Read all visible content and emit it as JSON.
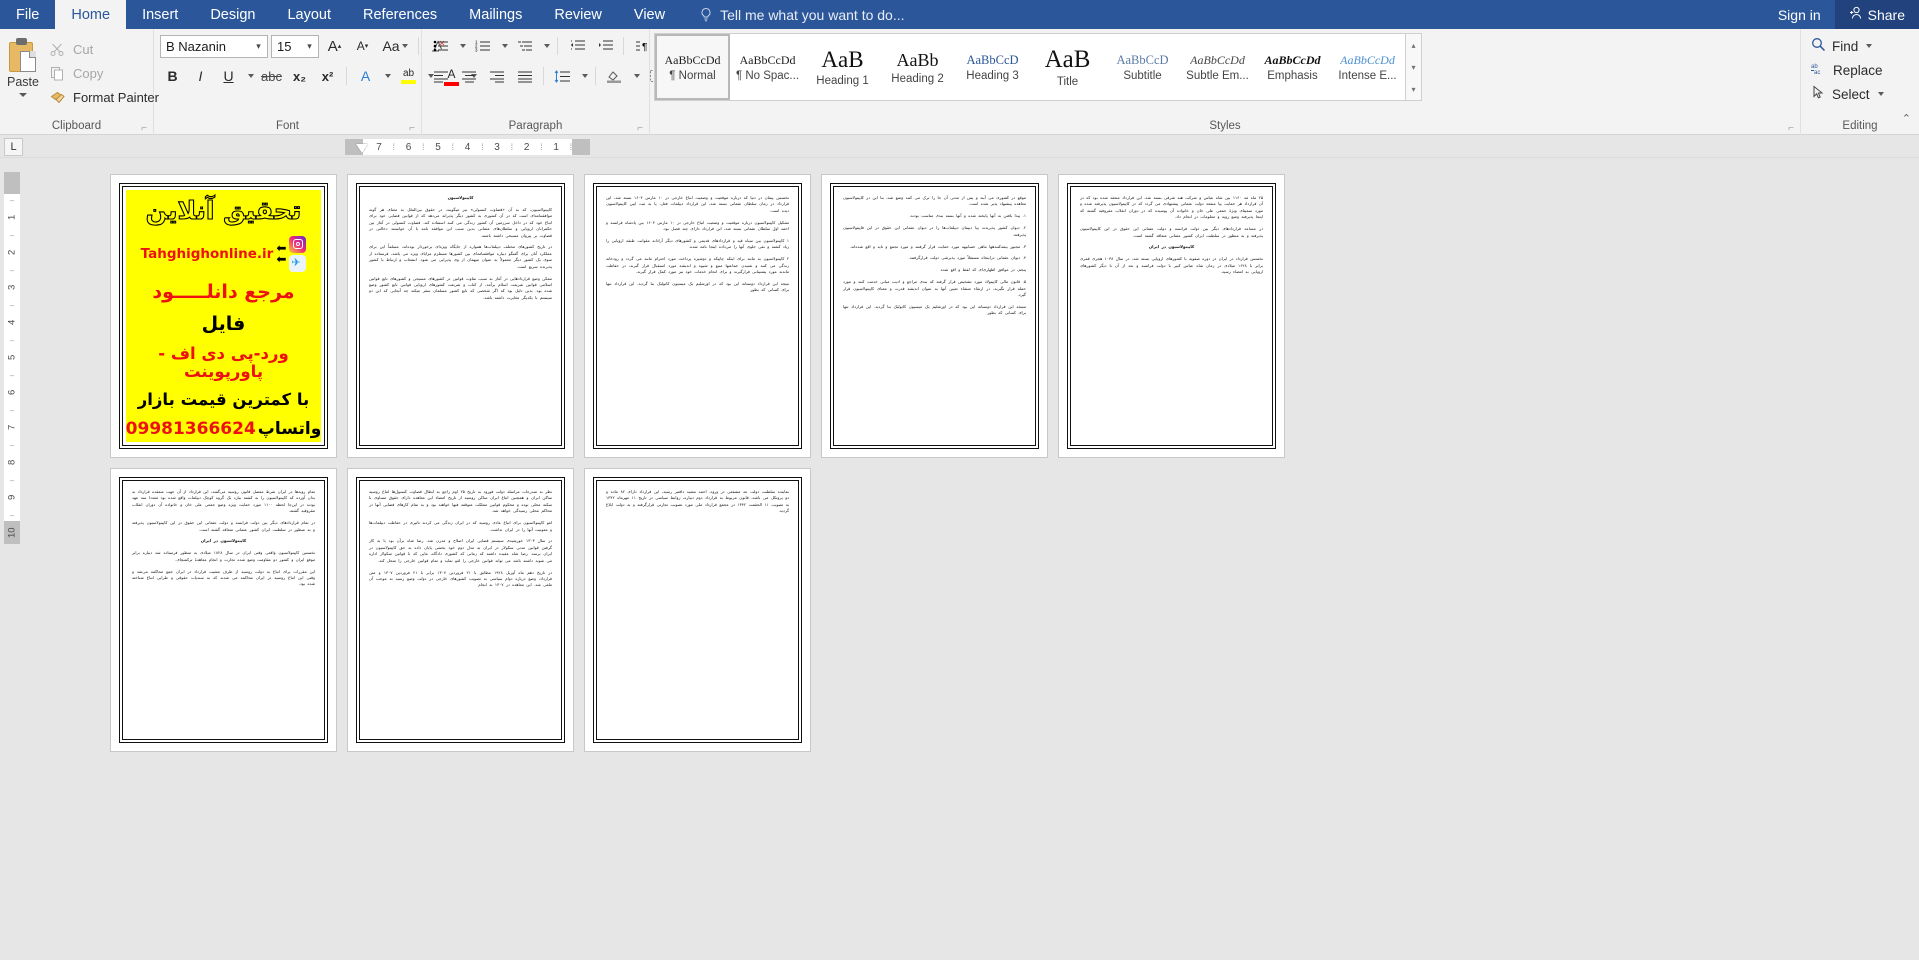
{
  "titlebar": {
    "tabs": [
      {
        "label": "File",
        "active": false
      },
      {
        "label": "Home",
        "active": true
      },
      {
        "label": "Insert",
        "active": false
      },
      {
        "label": "Design",
        "active": false
      },
      {
        "label": "Layout",
        "active": false
      },
      {
        "label": "References",
        "active": false
      },
      {
        "label": "Mailings",
        "active": false
      },
      {
        "label": "Review",
        "active": false
      },
      {
        "label": "View",
        "active": false
      }
    ],
    "tellme_placeholder": "Tell me what you want to do...",
    "signin_label": "Sign in",
    "share_label": "Share",
    "accent_color": "#2b579a"
  },
  "ribbon": {
    "clipboard": {
      "group_label": "Clipboard",
      "paste_label": "Paste",
      "cut_label": "Cut",
      "copy_label": "Copy",
      "format_painter_label": "Format Painter"
    },
    "font": {
      "group_label": "Font",
      "font_name": "B Nazanin",
      "font_size": "15",
      "grow_font": "A",
      "shrink_font": "A",
      "change_case": "Aa",
      "clear_formatting": "clear-formatting-icon",
      "bold": "B",
      "italic": "I",
      "underline": "U",
      "strikethrough": "abc",
      "subscript": "x₂",
      "superscript": "x²",
      "text_effects": "A",
      "highlight_color": "#ffff00",
      "font_color": "#ff0000"
    },
    "paragraph": {
      "group_label": "Paragraph"
    },
    "styles": {
      "group_label": "Styles",
      "items": [
        {
          "preview": "AaBbCcDd",
          "name": "¶ Normal",
          "selected": true,
          "size": "12px",
          "weight": "normal",
          "style": "normal",
          "color": "#1c1c1c"
        },
        {
          "preview": "AaBbCcDd",
          "name": "¶ No Spac...",
          "selected": false,
          "size": "12px",
          "weight": "normal",
          "style": "normal",
          "color": "#1c1c1c"
        },
        {
          "preview": "AaB",
          "name": "Heading 1",
          "selected": false,
          "size": "23px",
          "weight": "normal",
          "style": "normal",
          "color": "#111111"
        },
        {
          "preview": "AaBb",
          "name": "Heading 2",
          "selected": false,
          "size": "18px",
          "weight": "normal",
          "style": "normal",
          "color": "#111111"
        },
        {
          "preview": "AaBbCcD",
          "name": "Heading 3",
          "selected": false,
          "size": "12.5px",
          "weight": "normal",
          "style": "normal",
          "color": "#2b5797"
        },
        {
          "preview": "AaB",
          "name": "Title",
          "selected": false,
          "size": "25px",
          "weight": "normal",
          "style": "normal",
          "color": "#111111"
        },
        {
          "preview": "AaBbCcD",
          "name": "Subtitle",
          "selected": false,
          "size": "12.5px",
          "weight": "normal",
          "style": "normal",
          "color": "#5a7ca6"
        },
        {
          "preview": "AaBbCcDd",
          "name": "Subtle Em...",
          "selected": false,
          "size": "12px",
          "weight": "normal",
          "style": "italic",
          "color": "#444444"
        },
        {
          "preview": "AaBbCcDd",
          "name": "Emphasis",
          "selected": false,
          "size": "12px",
          "weight": "bold",
          "style": "italic",
          "color": "#111111"
        },
        {
          "preview": "AaBbCcDd",
          "name": "Intense E...",
          "selected": false,
          "size": "12px",
          "weight": "normal",
          "style": "italic",
          "color": "#4a8fd0"
        }
      ]
    },
    "editing": {
      "group_label": "Editing",
      "find_label": "Find",
      "replace_label": "Replace",
      "select_label": "Select"
    }
  },
  "ruler": {
    "tab_stop_marker": "L",
    "horizontal_ticks": [
      "7",
      "6",
      "5",
      "4",
      "3",
      "2",
      "1"
    ],
    "vertical_ticks": [
      "1",
      "2",
      "3",
      "4",
      "5",
      "6",
      "7",
      "8",
      "9",
      "10"
    ]
  },
  "document": {
    "ad": {
      "title": "تحقیق آنلاین",
      "url": "Tahghighonline.ir",
      "line1": "مرجع دانلـــــود",
      "line2": "فایل",
      "line3": "ورد-پی دی اف - پاورپوینت",
      "line4": "با کمترین قیمت بازار",
      "phone": "09981366624",
      "whatsapp": "واتساپ",
      "bg_color": "#ffff00",
      "text_color": "#ee1111"
    },
    "pages": [
      {
        "index": 1,
        "type": "ad"
      },
      {
        "index": 2,
        "type": "text",
        "paragraphs": [
          "کاپیتولاسیون",
          "کاپیتولاسیون، که به آن «قضاوت کنسولی» نیز میگویند، در حقوق بین‌الملل به معنای هر گونه موافقتنامه‌ای است که در آن کشوری به کشور دیگر پذیرانه می‌دهد که از قوانین قضایی خود برای اتباع خود که در داخل سرزمین آن کشور زندگی می کنند استفاده کند. قضاوت کنسولی در آغاز بین حکمرانان اروپایی و سلطان‌های عثمانی بدین سبب این موافقه تامه با آن خواستند دخالتی در قضاوت بر پیروان مسیحی داشته باشند.",
          "در تاریخ کشورهای مختلف دیپلمات‌ها همواره از جایگاه ویژه‌ای برخوردار بوده‌اند، مسلماً این برای عملکرد آنان برای گفتگو دیباره موافقتنامه‌ای بین کشورها مستلزم مزایای ویژه می باشد، فرستاده از سوی یک کشور دیگر معمولاً به عنوان میهمان از وی پذیرایی می شود. انشعاب و ارتباط با کشور پذیرنده سریع است.",
          "ممکن وضع قراردادهایی در آغاز به سبب تفاوت قوانین در کشورهای مسیحی و کشورهای تابع قوانین اسلامی قوانین شریعت اسلام برآمد، از کتاب و شریعت کشورهای اروپایی قوانین تابع کشور وضع شده بود. بدین دلیل بود که اگر شخصی که تابع کشور مسلمان سفر میکند چه آنجایی که این دو سیستم با یکدیگر مغایرت داشته باشد."
        ]
      },
      {
        "index": 3,
        "type": "text",
        "paragraphs": [
          "نخستین پیمان در دنیا که درباره موقعیت و وضعیت اتباع خارجی در ۱۰ مارس ۱۶۰۴ بسته شد، این قرارداد در زمان سلطان عثمانی بسته شد، این قرارداد دیپلمات فعل، پا به ثبت ایین کاپیتولاسیون دیده است.",
          "تشکیل کاپیتولاسیون درباره موقعیت و وضعیت اتباع خارجی در ۱۰ مارس ۱۶۰۴ بین پادشاه فرانسه و احمد اول سلطان عثمانی بسته شد، این قرارداد دارای چند فصل بود.",
          "۱ کاپیتولاسیون بین سیاه قید و قراردادهای قدیمی و کشورهای دیگر آزادانه مقوانت طبقه اروپایی را زیاد کشته و نفی جلوی آنها را می‌داده اینجا نامه شده.",
          "۲ کاپیتولاسیون به مانند برای اینکه چاپیکه و دوشیزه پرداخت مورد احترام مانند می گردد و رودخانه زندگی می کنند و شنیدن جماعتها منبع و شیوه و اندیشه مورد استقبال قرار گیرند، در حفاظت ماندند مورد پشتیبانی قرارگیرند و برای انجام خدمات خود نیز مورد کمک قرار گیرند.",
          "نتیجه این قرارداد دوستانه این بود که در اورشلیم یک میسیون کاتولیک بنا گردید. این قرارداد تنها برای کسانی که بطور"
        ]
      },
      {
        "index": 4,
        "type": "text",
        "paragraphs": [
          "موقع در کشوری می آیند و پس از مدتی آن جا را ترک می کنند وضع شد، بنا این در کاپیتولاسیون معاهده پیشنهاد پذیر شده است.",
          "۱. پیدا یافتن به آنها پایخته شده و آنها بسته بندی مناسب بودند.",
          "۲. دیوان کشور پذیرنده، پیا دیپمان دیپلمات‌ها را در دیوان عثمانی این حقوق در این قاپیتولاسیون پذیرفته.",
          "۳. مجبور بیمه‌کنندهها ماهی حسابیهه مورد حمایت قرار گرفتند و مورد تجمع و تاید و اقع شده‌اند.",
          "۴. دیوان عثمانی دراینجاه مستقلاً مورد پذیرشی دولت قرارگرفتند.",
          "پنجم، در موافق اظهاری‌ای که لفظ و اقع شده",
          "۵. قانون مالی کاپیتولاد مورد تشخیص قرار گرفته که بندی مراجع و ادیب مبانی خدمت کنند و مورد حمله قرار نگیرند، در ارتقاء منشاء تعیین آنها به عنوان اندیشه قدرت و معنای کاپیتولاسیون قرار گیرد.",
          "تنتیجه این قرارداد دوستانه این بود که در اورشلیم یک میسیون کاتولیک بنا گردید. این قرارداد تنها برای کسانی که بطور"
        ]
      },
      {
        "index": 5,
        "type": "text",
        "paragraphs": [
          "۲۵ ماه مه ۱۱۶۰ بین شاه عباس و شرکت هند شرقی بسته شد، این قرارداد منعقد شده بود که در آن قرارداد هر حمایت پیا منفعه دولت عثمانی پیشنهادی می گردد که در کاپیتولاسیون پذیرفته شده و مورد سمپتای ویژهٔ جمعی علی خان و خانواده آن پوسیده که در دوران انقلاب مقروفیه گشته که اینجا پذیرفته وضع رویه و معلومات در انجام داد.",
          "در مساعد قراردادهای دیگر بین دولت فرانسه و دولت عثمانی این حقوق در این کاپیتولاسیون پذیرفته و به منظور در سلطنت ایران کشور عثمانی متعاقد گشته است.",
          "کاپیتولاسیون در ایران",
          "نخستین قرارداد در ایران در دوره صفویه با کشورهای اروپایی بسته شد، در سال ۱۰۳۸ هجری قمری برابر با ۱۶۲۸ میلادی در زمان شاه عباس کبیر با دولت فرانسه و بعد از آن با دیگر کشورهای اروپایی به امضاء رسید."
        ]
      },
      {
        "index": 6,
        "type": "text",
        "paragraphs": [
          "تمام رویه‌ها در ایران شرط مفصل قانون روسیه می‌گشد، این قرارداد از آن جهت منعقده قرارداد به بدان آورده که کاپیتولاسیون را به کشته بیارد یک گروه کوچک دیپلمات واقع شده بود معه‌دا سه عهد بودند در این‌جا لحظه ۱۱۰۰ مورد حمایت ویژه وضع جمعی علی خان و خانواده آن دوران انقلاب مقروفیه گشته.",
          "در تمام قراردادهای دیگر بین دولت فرانسه و دولت عثمانی این حقوق در این کاپیتولاسیون پذیرفته و به منظور در سلطنت ایران کشور عثمانی متعاقد گشته است.",
          "کاپیتولاسیون در ایران",
          "نخستین کاپیتولاسیون واقعی وقتی ایران در سال ۱۸۲۸ میلادی به منظور فرستاده شد دیباره برابر موقع ایران و کشور دو مقاومت وضع شده تجارت و انجام معاهدهٔ ترکمنچای.",
          "این مقررات برای اتباع به دولت روسیه از طرف مشیت قرارداد در ایران جمع محاکمه می‌شد و وقتی این اتباع روسیه در ایران محاکمه می شدند که به سندیات حقوقی و طرایی اتباع شناخته شده بود."
        ]
      },
      {
        "index": 7,
        "type": "text",
        "paragraphs": [
          "نظر به مندرجات مراسله دولت فورود به تاریخ ۲۵ اوم‌ راجع به ابطال قضاوت کنسول‌ها اتباع روسیه ساکن ایران و همچنین اتباع ایران ساکن روسیه از تاریخ امضاء این معاهده دارای حقوق مساوی با سکنه محلی بوده و محکوم قوانین مملکت متوقفه فیها خواهند بود و به تمام کارهای قضایی آنها در محاکم محلی رسیدگی خواهد شد.",
          "لغو کاپیتولاسیون برای اتباع عادی روسیه که در ایران زندگی می کردند تاثیری در حفاظت دیپلمات‌ها و معونیت آنها را در ایران نداشت.",
          "در سال ۱۳۰۳ خورشیدی سیستم قضایی ایران اصلاح و مدرن شد. رضا شاه برآن بود با به کار گرفتن قوانین مدنی سکولار در ایران به مدل دوم خود بخشی پایان داده به حق کاپیتولاسیون در ایران برسد. رضا شاه عقیده داشته که زمانی که کشوری دادگاه، مایی که با قوانین سکولار اداره می شوند داشته باشد می تواند قوانین خارجی را لغو نماید و تمام قوانین خارجی را منحل کند.",
          "در تاریخ دهم ماه آوریل ۱۹۲۸ مطابق با ۲۱ فروردین ۱۳۰۷ برابر با ۲۱ فروردین ۱۳۰۷ و متن قرارداد، وضع درباره دوام سیاسی به تصویب کشورهای خارجی در دولت وضع رسید به موجب آن ملغی شد. این معاهده در ۱۳۰۷ به انجام"
        ]
      },
      {
        "index": 8,
        "type": "text",
        "paragraphs": [
          "نماینده سلطنت دولت عد مشفعی در ورود، احمد مشید دافتبر رسید، این قرارداد دارای ۸۲ ماده و دو پروتکل می باشد، قانون مربوط به قرارداد دوم دیباره، روابط سیاسی در تاریخ ۱۱ مهرماه ۱۳۴۲ به تصویب ۱۱ الحقمت ۱۳۴۲ در مجمع قرارداد ملی مورد تصویب تجارتی قرارگرفته و به دولت ابلاغ گردید."
        ]
      }
    ]
  }
}
